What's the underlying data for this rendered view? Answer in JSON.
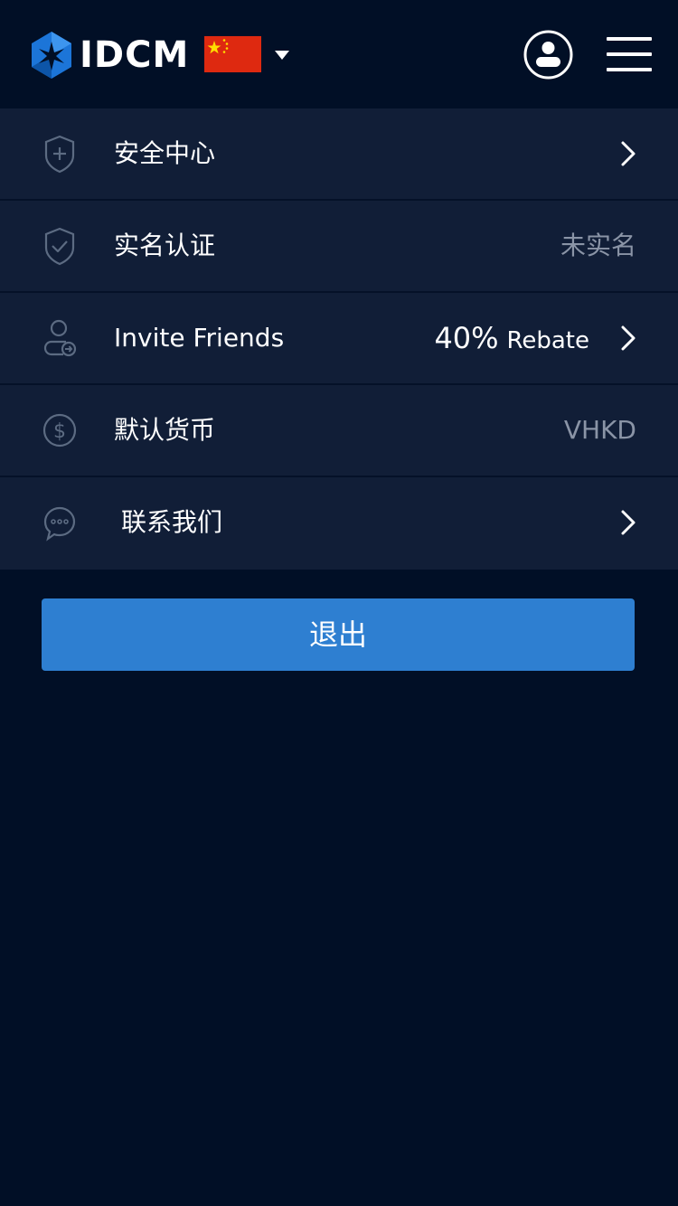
{
  "header": {
    "logo_text": "IDCM",
    "logo_icon": "idcm-hexagon-logo",
    "language_flag": "china-flag",
    "language_caret": "caret-down-icon",
    "account_icon": "user-circle-icon",
    "menu_icon": "hamburger-menu-icon"
  },
  "settings": {
    "items": [
      {
        "icon": "shield-plus-icon",
        "label": "安全中心",
        "value": "",
        "chevron": true
      },
      {
        "icon": "shield-check-icon",
        "label": "实名认证",
        "value": "未实名",
        "chevron": false
      },
      {
        "icon": "user-invite-icon",
        "label": "Invite Friends",
        "value_percent": "40%",
        "value_text": "Rebate",
        "chevron": true
      },
      {
        "icon": "dollar-circle-icon",
        "label": "默认货币",
        "value": "VHKD",
        "chevron": false
      },
      {
        "icon": "chat-bubble-icon",
        "label": "联系我们",
        "value": "",
        "chevron": true
      }
    ]
  },
  "logout": {
    "label": "退出"
  },
  "colors": {
    "background": "#010f26",
    "row_background": "#111e37",
    "accent": "#2e7fd1",
    "muted_text": "#8a94a6",
    "logo_blue": "#1c75d8",
    "flag_red": "#de2910",
    "flag_yellow": "#ffde00"
  }
}
